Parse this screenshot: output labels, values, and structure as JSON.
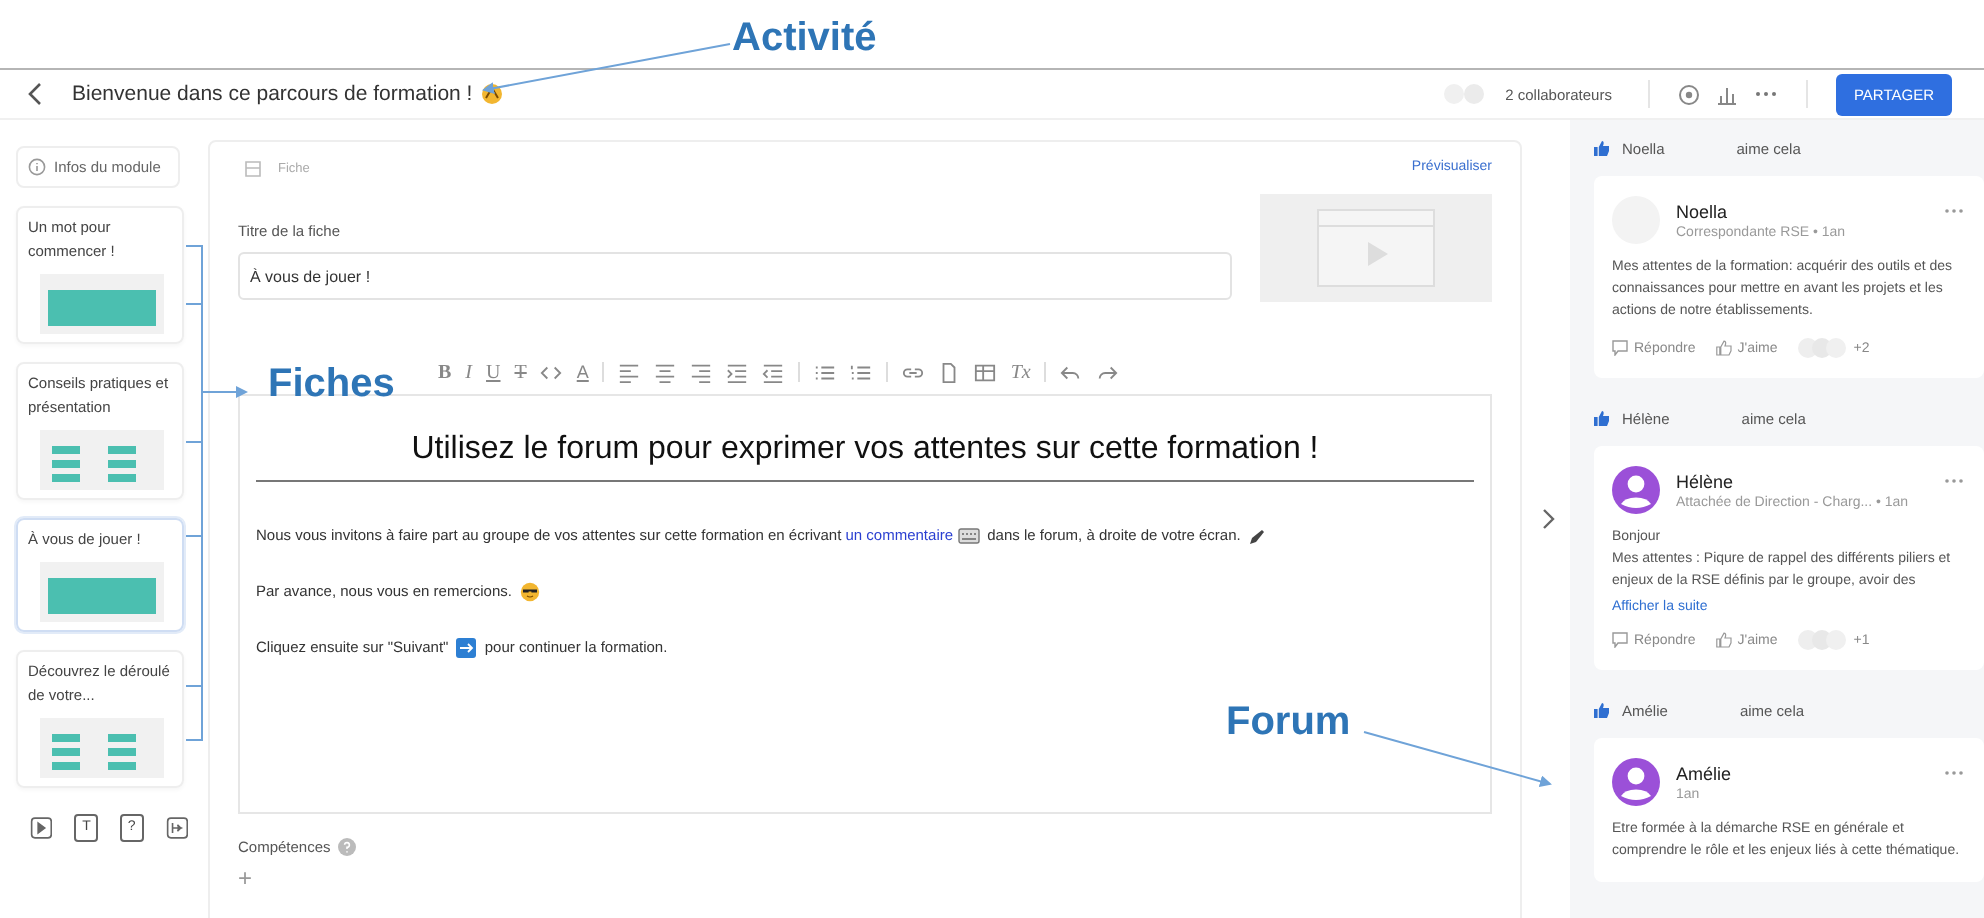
{
  "annotations": [
    {
      "kind": "activity",
      "label": "Activité"
    },
    {
      "kind": "sheets",
      "label": "Fiches"
    },
    {
      "kind": "forum",
      "label": "Forum"
    }
  ],
  "header": {
    "title": "Bienvenue dans ce parcours de formation !",
    "collaborators": "2 collaborateurs",
    "share_button": "PARTAGER"
  },
  "sidebar": {
    "info_button": "Infos du module",
    "items": [
      {
        "title": "Un mot pour commencer !",
        "selected": false
      },
      {
        "title": "Conseils pratiques et présentation",
        "selected": false
      },
      {
        "title": "À vous de jouer !",
        "selected": true
      },
      {
        "title": "Découvrez le déroulé de votre...",
        "selected": false
      }
    ],
    "tools": [
      {
        "kind": "video"
      },
      {
        "kind": "text",
        "text": "T"
      },
      {
        "kind": "quiz",
        "text": "?"
      },
      {
        "kind": "exit"
      }
    ]
  },
  "editor": {
    "type_label": "Fiche",
    "preview_link": "Prévisualiser",
    "title_label": "Titre de la fiche",
    "title_value": "À vous de jouer !",
    "toolbar": [
      {
        "kind": "bold",
        "text": "B"
      },
      {
        "kind": "italic",
        "text": "I"
      },
      {
        "kind": "underline",
        "text": "U"
      },
      {
        "kind": "strike",
        "text": "T"
      },
      {
        "kind": "code"
      },
      {
        "kind": "color",
        "text": "A"
      },
      {
        "kind": "sep"
      },
      {
        "kind": "align-left"
      },
      {
        "kind": "align-center"
      },
      {
        "kind": "align-right"
      },
      {
        "kind": "indent"
      },
      {
        "kind": "outdent"
      },
      {
        "kind": "sep"
      },
      {
        "kind": "bullet-list"
      },
      {
        "kind": "numbered-list"
      },
      {
        "kind": "sep"
      },
      {
        "kind": "link"
      },
      {
        "kind": "file"
      },
      {
        "kind": "table"
      },
      {
        "kind": "clear",
        "text": "Tx"
      },
      {
        "kind": "sep"
      },
      {
        "kind": "undo"
      },
      {
        "kind": "redo"
      }
    ],
    "heading": "Utilisez le forum pour exprimer vos attentes sur cette formation !",
    "paragraphs": [
      [
        {
          "kind": "text",
          "text": "Nous vous invitons à faire part au groupe de vos attentes sur cette formation en écrivant "
        },
        {
          "kind": "link",
          "text": "un commentaire"
        },
        {
          "kind": "keyboard"
        },
        {
          "kind": "text",
          "text": " dans le forum, à droite de votre écran. "
        },
        {
          "kind": "pencil"
        }
      ],
      [
        {
          "kind": "text",
          "text": "Par avance, nous vous en remercions. "
        },
        {
          "kind": "sunglasses"
        }
      ],
      [
        {
          "kind": "text",
          "text": "Cliquez ensuite sur \"Suivant\" "
        },
        {
          "kind": "next"
        },
        {
          "kind": "text",
          "text": " pour continuer la formation."
        }
      ]
    ],
    "skills_label": "Compétences",
    "add_symbol": "+"
  },
  "forum": {
    "posts": [
      {
        "liker": "Noella",
        "liked_text": "aime cela",
        "author": "Noella",
        "kind": "empty",
        "meta": "Correspondante RSE • 1an",
        "body": [
          "Mes attentes de la formation: acquérir des outils et des connaissances pour mettre en avant les projets et les actions de notre établissements."
        ],
        "reply": "Répondre",
        "like": "J'aime",
        "count": "+2"
      },
      {
        "liker": "Hélène",
        "liked_text": "aime cela",
        "author": "Hélène",
        "kind": "silhouette",
        "meta": "Attachée de Direction - Charg... • 1an",
        "body": [
          "Bonjour",
          "Mes attentes : Piqure de rappel des différents piliers et enjeux de la RSE définis par le groupe, avoir des"
        ],
        "more_link": "Afficher la suite",
        "reply": "Répondre",
        "like": "J'aime",
        "count": "+1"
      },
      {
        "liker": "Amélie",
        "liked_text": "aime cela",
        "author": "Amélie",
        "kind": "silhouette",
        "meta": "1an",
        "body": [
          "Etre formée à la démarche RSE en générale et comprendre le rôle et les enjeux liés à cette thématique."
        ]
      }
    ]
  }
}
